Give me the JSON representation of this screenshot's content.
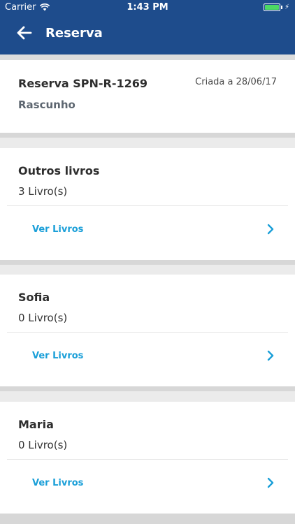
{
  "status": {
    "carrier": "Carrier",
    "time": "1:43 PM"
  },
  "header": {
    "title": "Reserva"
  },
  "reservation": {
    "code": "Reserva SPN-R-1269",
    "status": "Rascunho",
    "created": "Criada a 28/06/17"
  },
  "groups": [
    {
      "name": "Outros livros",
      "count": "3 Livro(s)",
      "link": "Ver Livros"
    },
    {
      "name": "Sofia",
      "count": "0 Livro(s)",
      "link": "Ver Livros"
    },
    {
      "name": "Maria",
      "count": "0 Livro(s)",
      "link": "Ver Livros"
    }
  ],
  "colors": {
    "appbar": "#1e4c8c",
    "link": "#1a9fd8"
  }
}
